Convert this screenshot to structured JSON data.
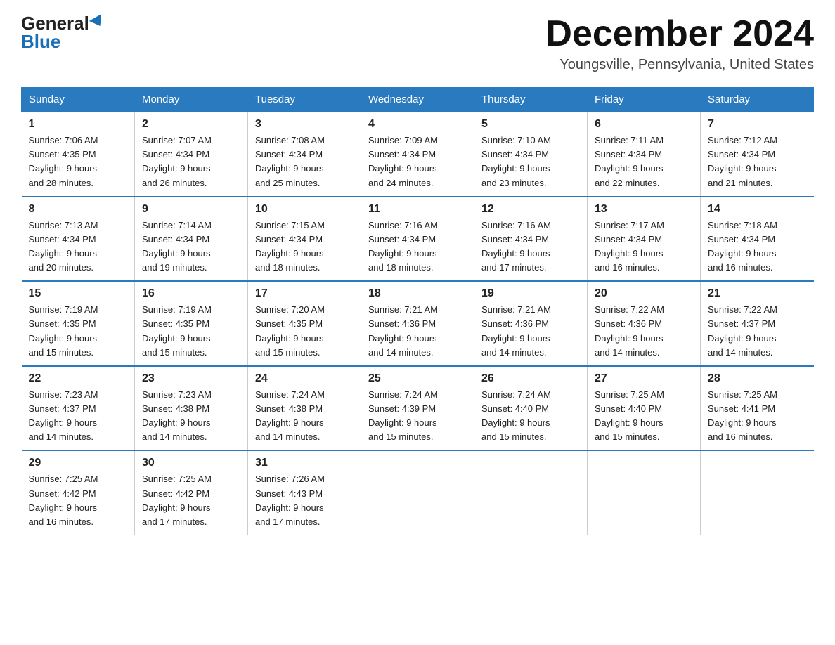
{
  "logo": {
    "general": "General",
    "blue": "Blue"
  },
  "title": {
    "month_year": "December 2024",
    "location": "Youngsville, Pennsylvania, United States"
  },
  "days_of_week": [
    "Sunday",
    "Monday",
    "Tuesday",
    "Wednesday",
    "Thursday",
    "Friday",
    "Saturday"
  ],
  "weeks": [
    [
      {
        "day": "1",
        "sunrise": "7:06 AM",
        "sunset": "4:35 PM",
        "daylight": "9 hours and 28 minutes."
      },
      {
        "day": "2",
        "sunrise": "7:07 AM",
        "sunset": "4:34 PM",
        "daylight": "9 hours and 26 minutes."
      },
      {
        "day": "3",
        "sunrise": "7:08 AM",
        "sunset": "4:34 PM",
        "daylight": "9 hours and 25 minutes."
      },
      {
        "day": "4",
        "sunrise": "7:09 AM",
        "sunset": "4:34 PM",
        "daylight": "9 hours and 24 minutes."
      },
      {
        "day": "5",
        "sunrise": "7:10 AM",
        "sunset": "4:34 PM",
        "daylight": "9 hours and 23 minutes."
      },
      {
        "day": "6",
        "sunrise": "7:11 AM",
        "sunset": "4:34 PM",
        "daylight": "9 hours and 22 minutes."
      },
      {
        "day": "7",
        "sunrise": "7:12 AM",
        "sunset": "4:34 PM",
        "daylight": "9 hours and 21 minutes."
      }
    ],
    [
      {
        "day": "8",
        "sunrise": "7:13 AM",
        "sunset": "4:34 PM",
        "daylight": "9 hours and 20 minutes."
      },
      {
        "day": "9",
        "sunrise": "7:14 AM",
        "sunset": "4:34 PM",
        "daylight": "9 hours and 19 minutes."
      },
      {
        "day": "10",
        "sunrise": "7:15 AM",
        "sunset": "4:34 PM",
        "daylight": "9 hours and 18 minutes."
      },
      {
        "day": "11",
        "sunrise": "7:16 AM",
        "sunset": "4:34 PM",
        "daylight": "9 hours and 18 minutes."
      },
      {
        "day": "12",
        "sunrise": "7:16 AM",
        "sunset": "4:34 PM",
        "daylight": "9 hours and 17 minutes."
      },
      {
        "day": "13",
        "sunrise": "7:17 AM",
        "sunset": "4:34 PM",
        "daylight": "9 hours and 16 minutes."
      },
      {
        "day": "14",
        "sunrise": "7:18 AM",
        "sunset": "4:34 PM",
        "daylight": "9 hours and 16 minutes."
      }
    ],
    [
      {
        "day": "15",
        "sunrise": "7:19 AM",
        "sunset": "4:35 PM",
        "daylight": "9 hours and 15 minutes."
      },
      {
        "day": "16",
        "sunrise": "7:19 AM",
        "sunset": "4:35 PM",
        "daylight": "9 hours and 15 minutes."
      },
      {
        "day": "17",
        "sunrise": "7:20 AM",
        "sunset": "4:35 PM",
        "daylight": "9 hours and 15 minutes."
      },
      {
        "day": "18",
        "sunrise": "7:21 AM",
        "sunset": "4:36 PM",
        "daylight": "9 hours and 14 minutes."
      },
      {
        "day": "19",
        "sunrise": "7:21 AM",
        "sunset": "4:36 PM",
        "daylight": "9 hours and 14 minutes."
      },
      {
        "day": "20",
        "sunrise": "7:22 AM",
        "sunset": "4:36 PM",
        "daylight": "9 hours and 14 minutes."
      },
      {
        "day": "21",
        "sunrise": "7:22 AM",
        "sunset": "4:37 PM",
        "daylight": "9 hours and 14 minutes."
      }
    ],
    [
      {
        "day": "22",
        "sunrise": "7:23 AM",
        "sunset": "4:37 PM",
        "daylight": "9 hours and 14 minutes."
      },
      {
        "day": "23",
        "sunrise": "7:23 AM",
        "sunset": "4:38 PM",
        "daylight": "9 hours and 14 minutes."
      },
      {
        "day": "24",
        "sunrise": "7:24 AM",
        "sunset": "4:38 PM",
        "daylight": "9 hours and 14 minutes."
      },
      {
        "day": "25",
        "sunrise": "7:24 AM",
        "sunset": "4:39 PM",
        "daylight": "9 hours and 15 minutes."
      },
      {
        "day": "26",
        "sunrise": "7:24 AM",
        "sunset": "4:40 PM",
        "daylight": "9 hours and 15 minutes."
      },
      {
        "day": "27",
        "sunrise": "7:25 AM",
        "sunset": "4:40 PM",
        "daylight": "9 hours and 15 minutes."
      },
      {
        "day": "28",
        "sunrise": "7:25 AM",
        "sunset": "4:41 PM",
        "daylight": "9 hours and 16 minutes."
      }
    ],
    [
      {
        "day": "29",
        "sunrise": "7:25 AM",
        "sunset": "4:42 PM",
        "daylight": "9 hours and 16 minutes."
      },
      {
        "day": "30",
        "sunrise": "7:25 AM",
        "sunset": "4:42 PM",
        "daylight": "9 hours and 17 minutes."
      },
      {
        "day": "31",
        "sunrise": "7:26 AM",
        "sunset": "4:43 PM",
        "daylight": "9 hours and 17 minutes."
      },
      null,
      null,
      null,
      null
    ]
  ],
  "labels": {
    "sunrise": "Sunrise:",
    "sunset": "Sunset:",
    "daylight": "Daylight:"
  }
}
